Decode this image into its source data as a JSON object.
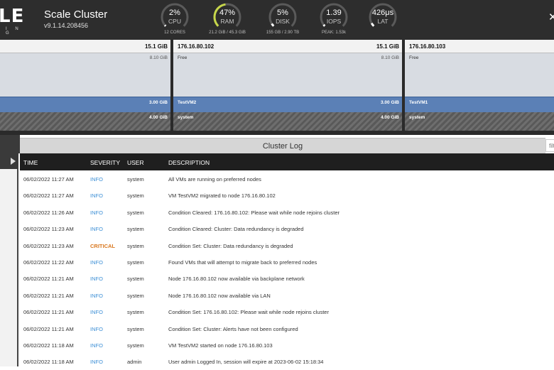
{
  "header": {
    "logo_text": "LE",
    "logo_subtext": "I N G",
    "cluster_name": "Scale Cluster",
    "version": "v9.1.14.208456",
    "close_icon": "close-icon",
    "gauges": [
      {
        "value": "2%",
        "label": "CPU",
        "sub": "12 CORES",
        "fraction": 0.02,
        "color": "#ffffff"
      },
      {
        "value": "47%",
        "label": "RAM",
        "sub": "21.2 GiB / 45.3 GiB",
        "fraction": 0.47,
        "color": "#c6d64a"
      },
      {
        "value": "5%",
        "label": "DISK",
        "sub": "155 GB / 2.90 TB",
        "fraction": 0.05,
        "color": "#ffffff"
      },
      {
        "value": "1.39",
        "label": "IOPS",
        "sub": "PEAK: 1.53k",
        "fraction": 0.03,
        "color": "#ffffff"
      },
      {
        "value": "426μs",
        "label": "LAT",
        "sub": "",
        "fraction": 0.06,
        "color": "#ffffff"
      }
    ]
  },
  "nodes": [
    {
      "ip": "",
      "capacity": "15.1 GiB",
      "free_label": "",
      "free_size": "8.10 GiB",
      "vm_label": "",
      "vm_size": "3.00 GiB",
      "sys_label": "",
      "sys_size": "4.00 GiB"
    },
    {
      "ip": "176.16.80.102",
      "capacity": "15.1 GiB",
      "free_label": "Free",
      "free_size": "8.10 GiB",
      "vm_label": "TestVM2",
      "vm_size": "3.00 GiB",
      "sys_label": "system",
      "sys_size": "4.00 GiB"
    },
    {
      "ip": "176.16.80.103",
      "capacity": "",
      "free_label": "Free",
      "free_size": "",
      "vm_label": "TestVM1",
      "vm_size": "",
      "sys_label": "system",
      "sys_size": ""
    }
  ],
  "log": {
    "title": "Cluster Log",
    "filter_placeholder": "filt",
    "columns": {
      "time": "TIME",
      "severity": "SEVERITY",
      "user": "USER",
      "description": "DESCRIPTION"
    },
    "rows": [
      {
        "time": "06/02/2022 11:27 AM",
        "severity": "INFO",
        "user": "system",
        "description": "All VMs are running on preferred nodes"
      },
      {
        "time": "06/02/2022 11:27 AM",
        "severity": "INFO",
        "user": "system",
        "description": "VM TestVM2 migrated to node 176.16.80.102"
      },
      {
        "time": "06/02/2022 11:26 AM",
        "severity": "INFO",
        "user": "system",
        "description": "Condition Cleared: 176.16.80.102: Please wait while node rejoins cluster"
      },
      {
        "time": "06/02/2022 11:23 AM",
        "severity": "INFO",
        "user": "system",
        "description": "Condition Cleared: Cluster: Data redundancy is degraded"
      },
      {
        "time": "06/02/2022 11:23 AM",
        "severity": "CRITICAL",
        "user": "system",
        "description": "Condition Set: Cluster: Data redundancy is degraded"
      },
      {
        "time": "06/02/2022 11:22 AM",
        "severity": "INFO",
        "user": "system",
        "description": "Found VMs that will attempt to migrate back to preferred nodes"
      },
      {
        "time": "06/02/2022 11:21 AM",
        "severity": "INFO",
        "user": "system",
        "description": "Node 176.16.80.102 now available via backplane network"
      },
      {
        "time": "06/02/2022 11:21 AM",
        "severity": "INFO",
        "user": "system",
        "description": "Node 176.16.80.102 now available via LAN"
      },
      {
        "time": "06/02/2022 11:21 AM",
        "severity": "INFO",
        "user": "system",
        "description": "Condition Set: 176.16.80.102: Please wait while node rejoins cluster"
      },
      {
        "time": "06/02/2022 11:21 AM",
        "severity": "INFO",
        "user": "system",
        "description": "Condition Set: Cluster: Alerts have not been configured"
      },
      {
        "time": "06/02/2022 11:18 AM",
        "severity": "INFO",
        "user": "system",
        "description": "VM TestVM2 started on node 176.16.80.103"
      },
      {
        "time": "06/02/2022 11:18 AM",
        "severity": "INFO",
        "user": "admin",
        "description": "User admin Logged In, session will expire at 2023-06-02 15:18:34"
      }
    ]
  }
}
